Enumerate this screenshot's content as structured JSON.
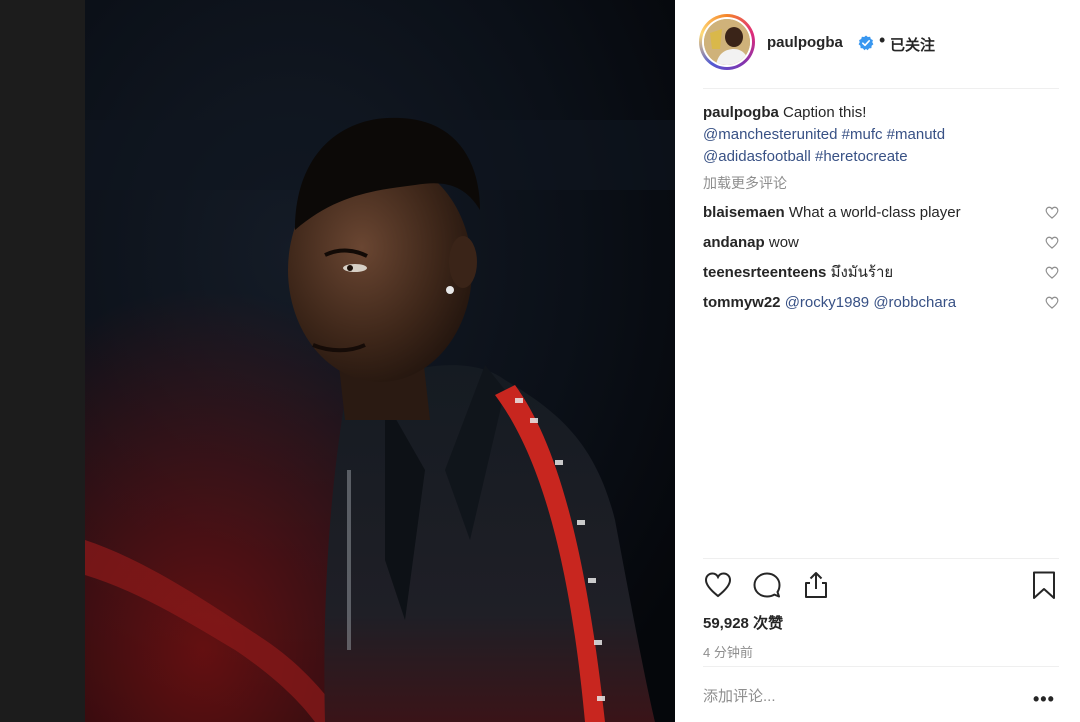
{
  "post": {
    "author": "paulpogba",
    "follow_status": "已关注",
    "separator": "•"
  },
  "caption": {
    "username": "paulpogba",
    "text": "Caption this!",
    "mention1": "@manchesterunited",
    "hashtag1": "#mufc",
    "hashtag2": "#manutd",
    "mention2": "@adidasfootball",
    "hashtag3": "#heretocreate"
  },
  "load_more_comments": "加载更多评论",
  "comments": [
    {
      "username": "blaisemaen",
      "text": "What a world-class player"
    },
    {
      "username": "andanap",
      "text": "wow"
    },
    {
      "username": "teenesrteenteens",
      "text": "มึงมันร้าย"
    },
    {
      "username": "tommyw22",
      "mention1": "@rocky1989",
      "mention2": "@robbchara"
    }
  ],
  "likes": {
    "count": "59,928",
    "unit": "次赞"
  },
  "timestamp": "4 分钟前",
  "comment_input": {
    "placeholder": "添加评论..."
  },
  "more_options": "•••",
  "icons": {
    "like": "heart-icon",
    "comment": "comment-bubble-icon",
    "share": "share-icon",
    "save": "bookmark-icon",
    "verified": "verified-badge-icon"
  },
  "colors": {
    "link": "#385185",
    "verified": "#3897f0",
    "muted": "#8e8e8e",
    "text": "#262626"
  }
}
